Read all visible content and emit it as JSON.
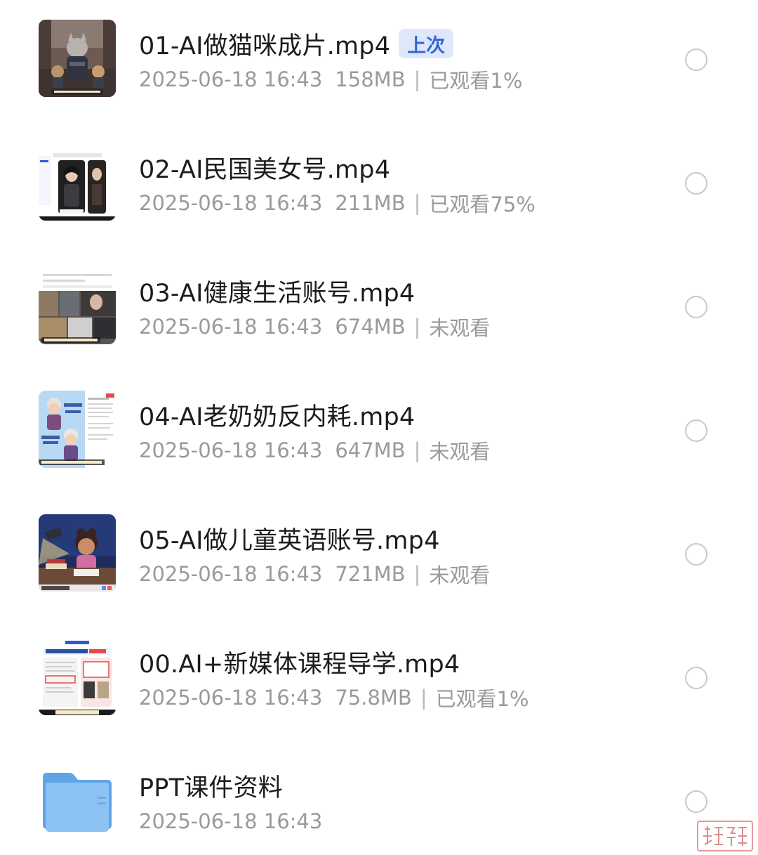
{
  "files": [
    {
      "name": "01-AI做猫咪成片.mp4",
      "badge": "上次",
      "date": "2025-06-18 16:43",
      "size": "158MB",
      "status": "已观看1%",
      "thumbnail": "cat-video-thumbnail"
    },
    {
      "name": "02-AI民国美女号.mp4",
      "date": "2025-06-18 16:43",
      "size": "211MB",
      "status": "已观看75%",
      "thumbnail": "republic-era-woman-thumbnail"
    },
    {
      "name": "03-AI健康生活账号.mp4",
      "date": "2025-06-18 16:43",
      "size": "674MB",
      "status": "未观看",
      "thumbnail": "healthy-life-collage-thumbnail"
    },
    {
      "name": "04-AI老奶奶反内耗.mp4",
      "date": "2025-06-18 16:43",
      "size": "647MB",
      "status": "未观看",
      "thumbnail": "grandma-cartoon-thumbnail"
    },
    {
      "name": "05-AI做儿童英语账号.mp4",
      "date": "2025-06-18 16:43",
      "size": "721MB",
      "status": "未观看",
      "thumbnail": "child-studying-thumbnail"
    },
    {
      "name": "00.AI+新媒体课程导学.mp4",
      "date": "2025-06-18 16:43",
      "size": "75.8MB",
      "status": "已观看1%",
      "thumbnail": "course-intro-slide-thumbnail"
    },
    {
      "name": "PPT课件资料",
      "date": "2025-06-18 16:43",
      "thumbnail": "folder-icon"
    }
  ],
  "colors": {
    "title": "#1c1c1c",
    "meta": "#9a9a9a",
    "badge_bg": "#dfe8fb",
    "badge_text": "#3566d6",
    "radio_border": "#c9c9c9",
    "folder": "#7cb8f2"
  },
  "watermark_text": "送锋"
}
